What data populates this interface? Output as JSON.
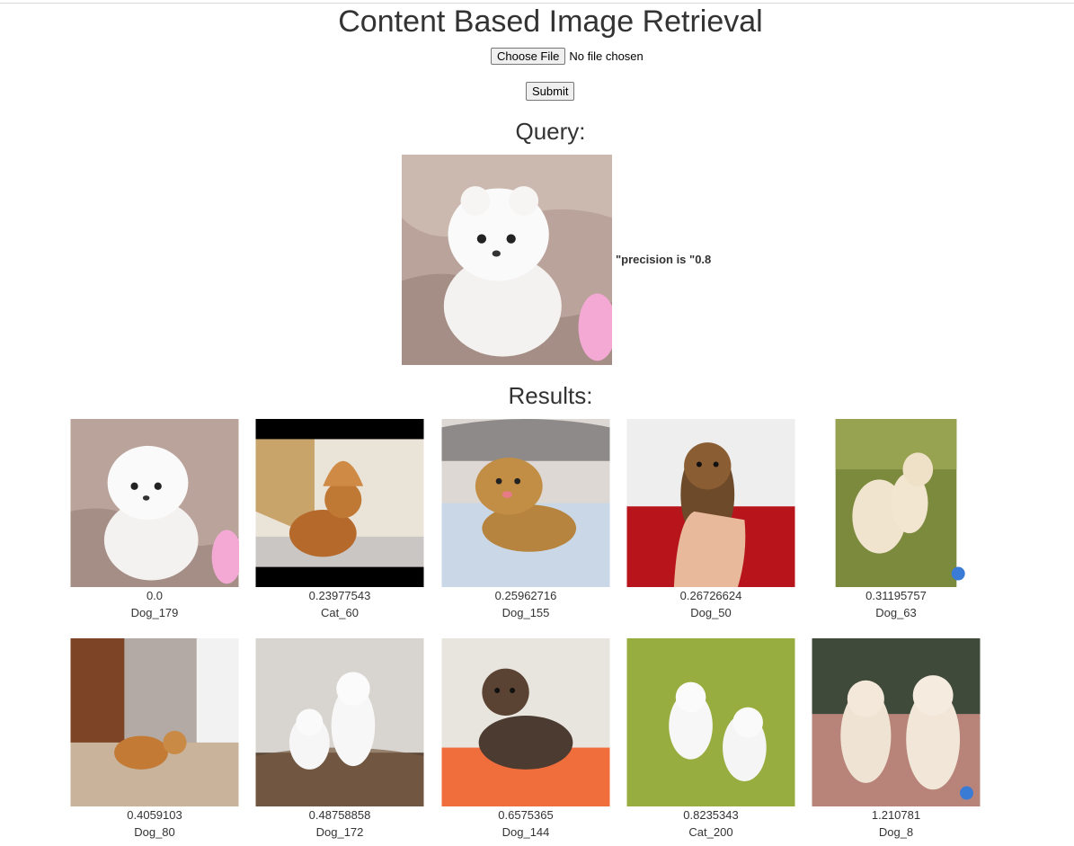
{
  "page": {
    "title": "Content Based Image Retrieval",
    "file_button_label": "Choose File",
    "file_status": "No file chosen",
    "submit_label": "Submit",
    "query_heading": "Query:",
    "precision_text": "\"precision is \"0.8",
    "results_heading": "Results:"
  },
  "results": [
    {
      "score": "0.0",
      "label": "Dog_179"
    },
    {
      "score": "0.23977543",
      "label": "Cat_60"
    },
    {
      "score": "0.25962716",
      "label": "Dog_155"
    },
    {
      "score": "0.26726624",
      "label": "Dog_50"
    },
    {
      "score": "0.31195757",
      "label": "Dog_63"
    },
    {
      "score": "0.4059103",
      "label": "Dog_80"
    },
    {
      "score": "0.48758858",
      "label": "Dog_172"
    },
    {
      "score": "0.6575365",
      "label": "Dog_144"
    },
    {
      "score": "0.8235343",
      "label": "Cat_200"
    },
    {
      "score": "1.210781",
      "label": "Dog_8"
    }
  ]
}
